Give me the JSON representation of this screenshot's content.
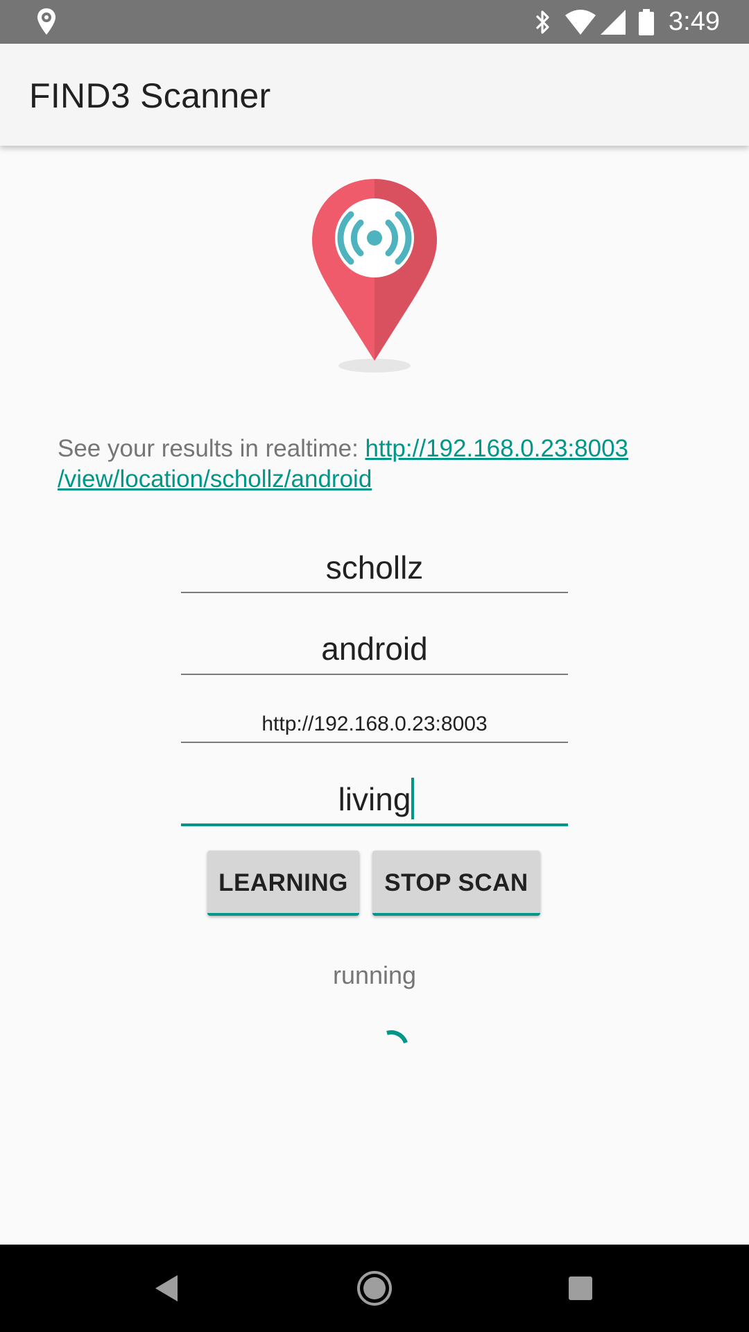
{
  "status_bar": {
    "time": "3:49",
    "icons": [
      "location-pin-icon",
      "bluetooth-icon",
      "wifi-icon",
      "signal-icon",
      "battery-icon"
    ]
  },
  "app_bar": {
    "title": "FIND3 Scanner"
  },
  "logo": {
    "icon": "find3-location-wifi-logo",
    "colors": {
      "pin": "#f05b6c",
      "pin_shade": "#d9505f",
      "wave": "#4fb3bf"
    }
  },
  "realtime": {
    "prefix": "See your results in realtime: ",
    "link_line1": "http://192.168.0.23:8003",
    "link_line2": "/view/location/schollz/android"
  },
  "form": {
    "family": "schollz",
    "device": "android",
    "server": "http://192.168.0.23:8003",
    "location": "living"
  },
  "buttons": {
    "learning": "LEARNING",
    "stop_scan": "STOP SCAN"
  },
  "status_text": "running",
  "accent_color": "#009688",
  "nav_bar": {
    "icons": [
      "back-icon",
      "home-icon",
      "recents-icon"
    ]
  }
}
